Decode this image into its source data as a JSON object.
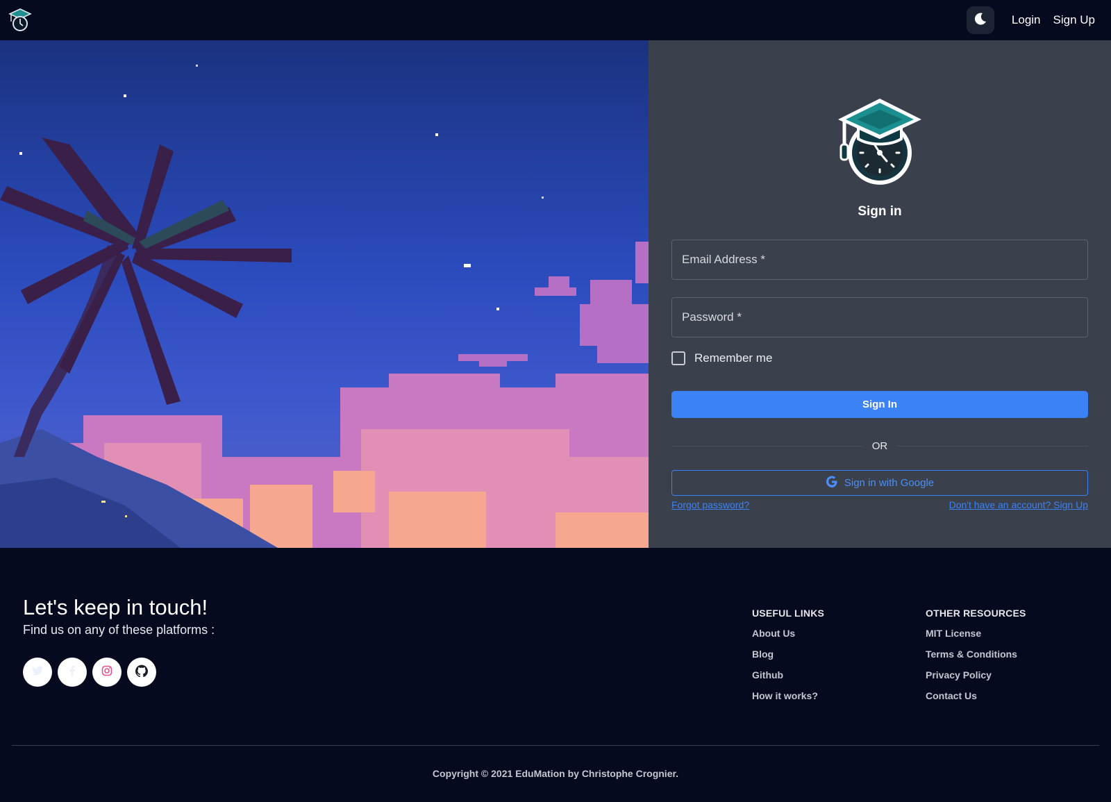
{
  "navbar": {
    "logo_icon": "graduation-cap-clock-icon",
    "theme_toggle_icon": "moon-icon",
    "login_label": "Login",
    "signup_label": "Sign Up"
  },
  "hero": {
    "image": "pixel-art palm tree at night with pink clouds"
  },
  "signin": {
    "logo_icon": "graduation-cap-clock-icon",
    "title": "Sign in",
    "email_placeholder": "Email Address *",
    "password_placeholder": "Password *",
    "remember_label": "Remember me",
    "submit_label": "Sign In",
    "or_label": "OR",
    "google_label": "Sign in with Google",
    "google_icon": "google-g-icon",
    "forgot_label": "Forgot password?",
    "signup_link_label": "Don't have an account? Sign Up"
  },
  "footer": {
    "title": "Let's keep in touch!",
    "subtitle": "Find us on any of these platforms :",
    "socials": [
      {
        "icon": "twitter-icon"
      },
      {
        "icon": "facebook-icon"
      },
      {
        "icon": "instagram-icon"
      },
      {
        "icon": "github-icon"
      }
    ],
    "useful_links": {
      "heading": "USEFUL LINKS",
      "items": [
        "About Us",
        "Blog",
        "Github",
        "How it works?"
      ]
    },
    "other_resources": {
      "heading": "OTHER RESOURCES",
      "items": [
        "MIT License",
        "Terms & Conditions",
        "Privacy Policy",
        "Contact Us"
      ]
    },
    "copyright": "Copyright © 2021 EduMation by Christophe Crognier."
  },
  "colors": {
    "nav_bg": "#050a1f",
    "panel_bg": "#3a404c",
    "accent": "#3b82f6"
  }
}
